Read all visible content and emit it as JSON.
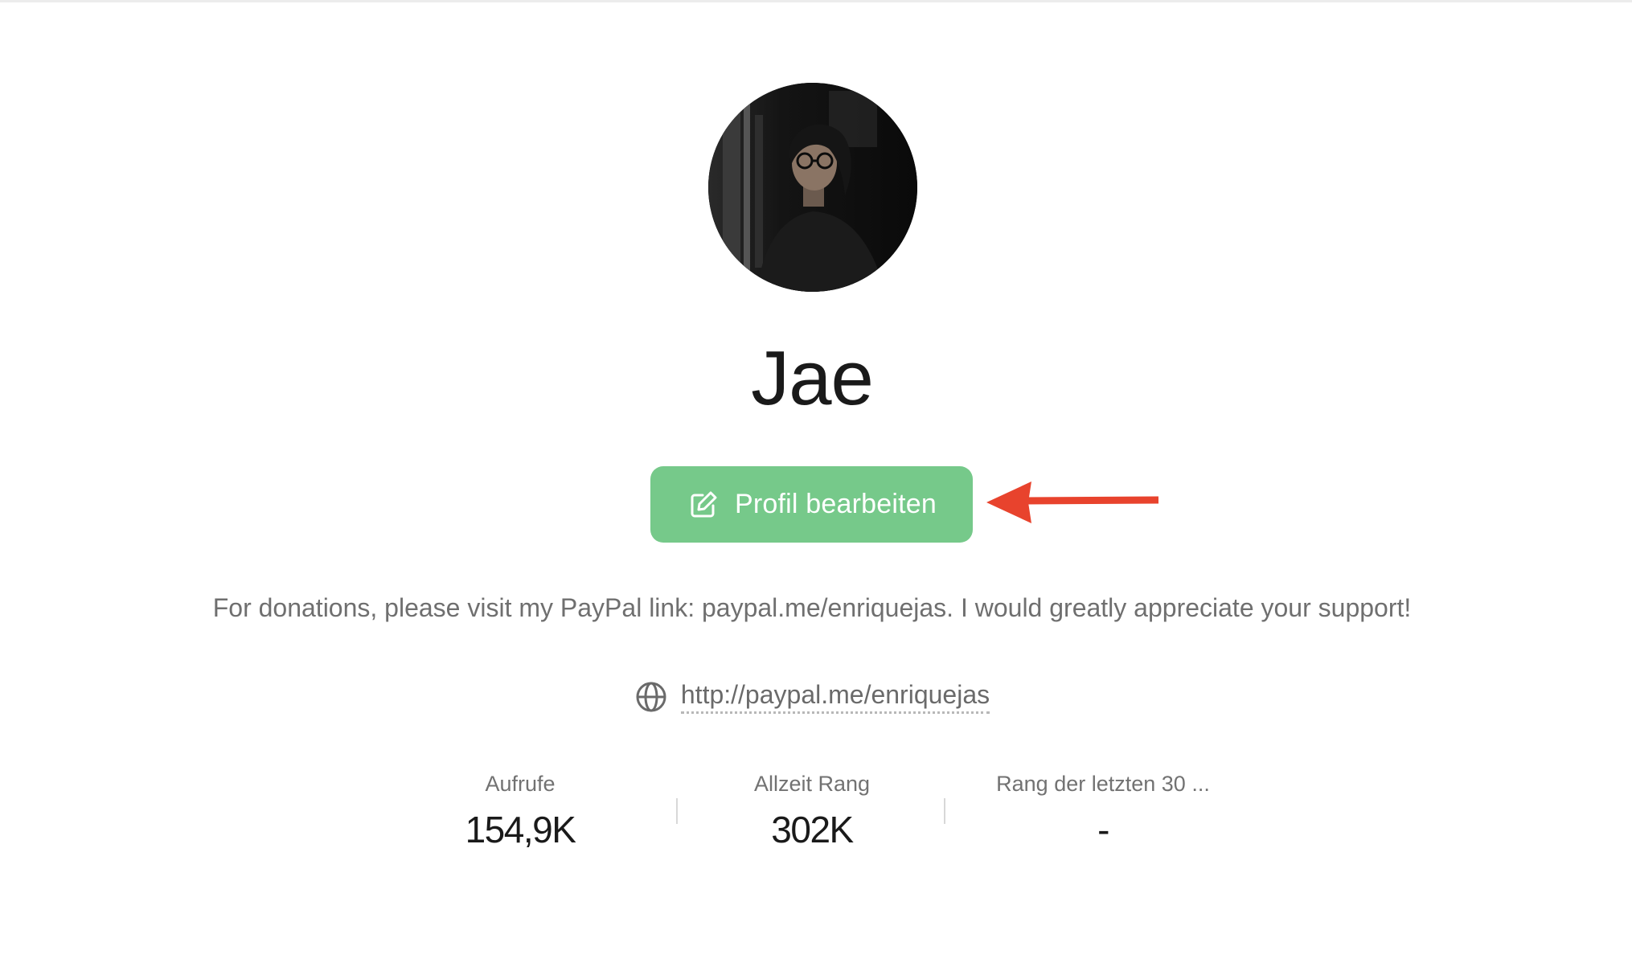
{
  "profile": {
    "name": "Jae",
    "edit_button_label": "Profil bearbeiten",
    "bio": "For donations, please visit my PayPal link: paypal.me/enriquejas. I would greatly appreciate your support!",
    "website": "http://paypal.me/enriquejas"
  },
  "stats": [
    {
      "label": "Aufrufe",
      "value": "154,9K"
    },
    {
      "label": "Allzeit Rang",
      "value": "302K"
    },
    {
      "label": "Rang der letzten 30 ...",
      "value": "-"
    }
  ],
  "icons": {
    "edit": "edit-icon",
    "globe": "globe-icon",
    "annotation": "red-arrow-pointing-left"
  },
  "colors": {
    "button_green": "#76c98a",
    "annotation_red": "#e8432d",
    "muted_text": "#6f6f6f"
  }
}
